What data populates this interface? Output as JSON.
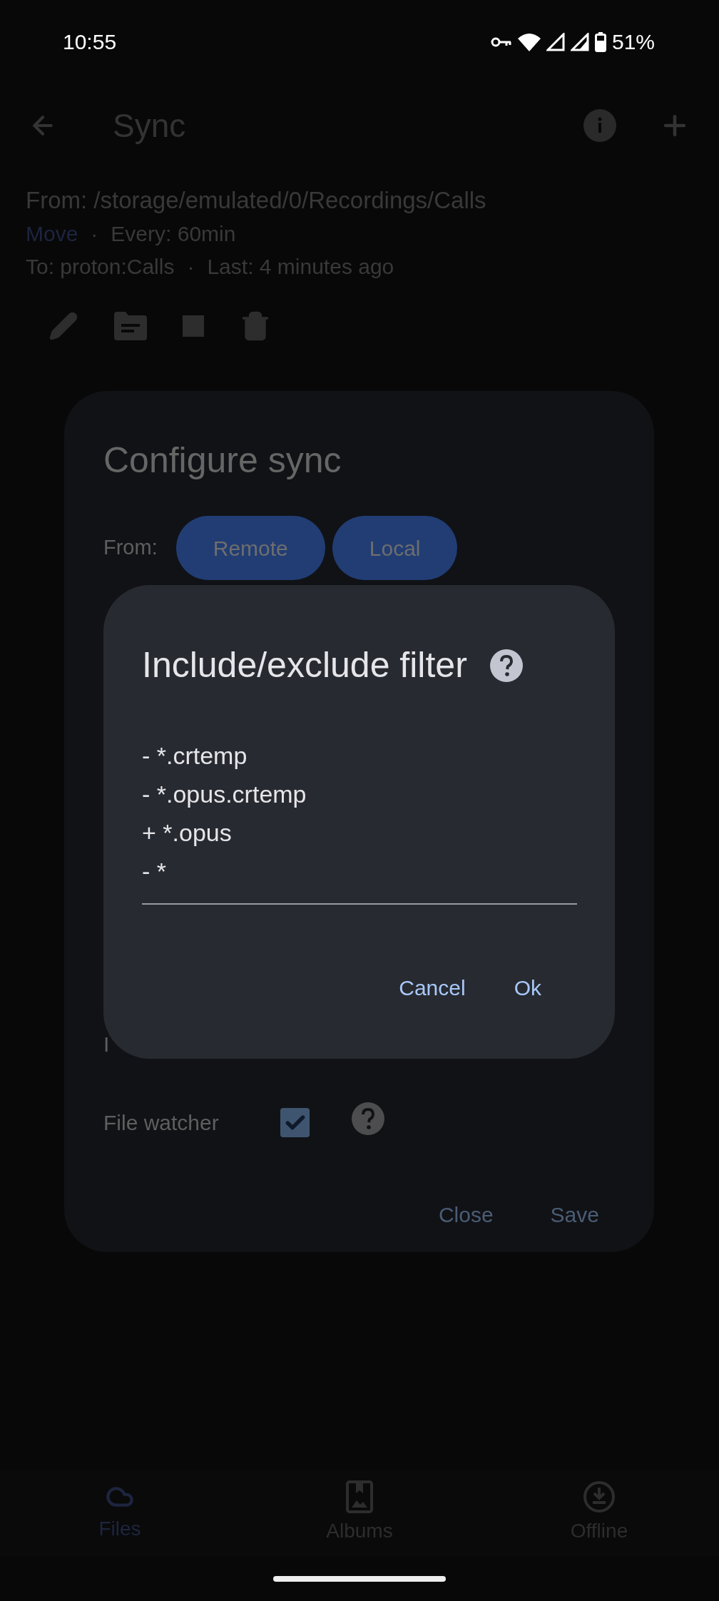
{
  "status_bar": {
    "time": "10:55",
    "battery": "51%"
  },
  "app_bar": {
    "title": "Sync"
  },
  "sync_item": {
    "from": "From: /storage/emulated/0/Recordings/Calls",
    "mode": "Move",
    "separator_1": "·",
    "every": "Every: 60min",
    "to": "To: proton:Calls",
    "separator_2": "·",
    "last": "Last: 4 minutes ago"
  },
  "configure_dialog": {
    "title": "Configure sync",
    "from_label": "From:",
    "from_options": [
      {
        "label": "Remote"
      },
      {
        "label": "Local"
      }
    ],
    "covered_label": "I",
    "file_watcher": {
      "label": "File watcher",
      "checked": true
    },
    "buttons": [
      "Close",
      "Save"
    ]
  },
  "filter_dialog": {
    "title": "Include/exclude filter",
    "value": "- *.crtemp\n- *.opus.crtemp\n+ *.opus\n- *",
    "buttons": [
      "Cancel",
      "Ok"
    ]
  },
  "bottom_nav": [
    {
      "label": "Files",
      "selected": true
    },
    {
      "label": "Albums",
      "selected": false
    },
    {
      "label": "Offline",
      "selected": false
    }
  ]
}
